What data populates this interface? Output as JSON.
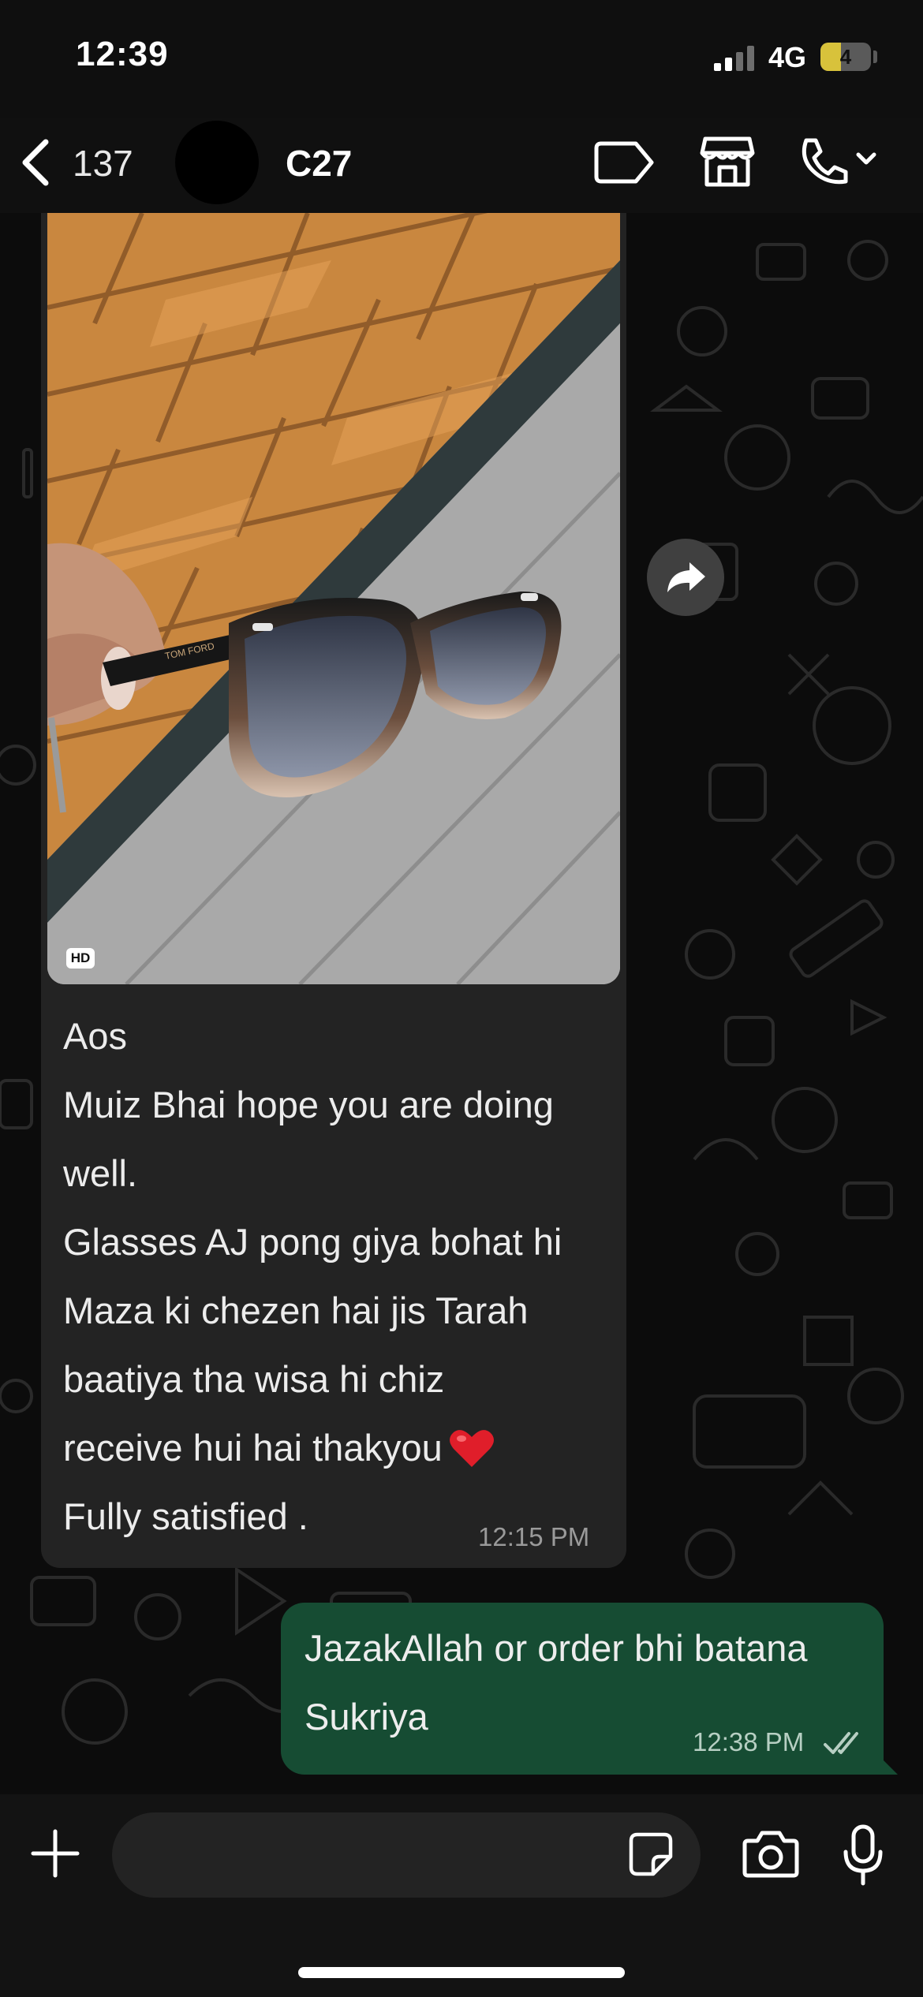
{
  "status_bar": {
    "time": "12:39",
    "network": "4G",
    "battery": "4",
    "battery_level": 0.4
  },
  "header": {
    "back_count": "137",
    "contact_name": "C27"
  },
  "message_in": {
    "hd_label": "HD",
    "lines": [
      "Aos",
      "Muiz Bhai hope you are doing",
      "well.",
      "Glasses AJ pong giya bohat hi",
      "Maza ki chezen hai jis Tarah",
      "baatiya tha wisa hi chiz",
      "receive hui hai thakyou",
      "Fully satisfied ."
    ],
    "time": "12:15 PM"
  },
  "message_out": {
    "lines": [
      "JazakAllah or order bhi batana",
      "Sukriya"
    ],
    "time": "12:38 PM"
  },
  "composer": {
    "value": "",
    "placeholder": ""
  },
  "icons": {
    "back": "chevron-left-icon",
    "label": "label-tag-icon",
    "store": "store-icon",
    "call": "phone-icon",
    "forward": "forward-icon",
    "plus": "plus-icon",
    "sticker": "sticker-icon",
    "camera": "camera-icon",
    "mic": "microphone-icon",
    "heart": "red-heart-emoji",
    "read": "double-check-icon"
  },
  "colors": {
    "outgoing_bubble": "#164c33",
    "incoming_bubble": "#232323",
    "heart": "#e01e2a"
  }
}
